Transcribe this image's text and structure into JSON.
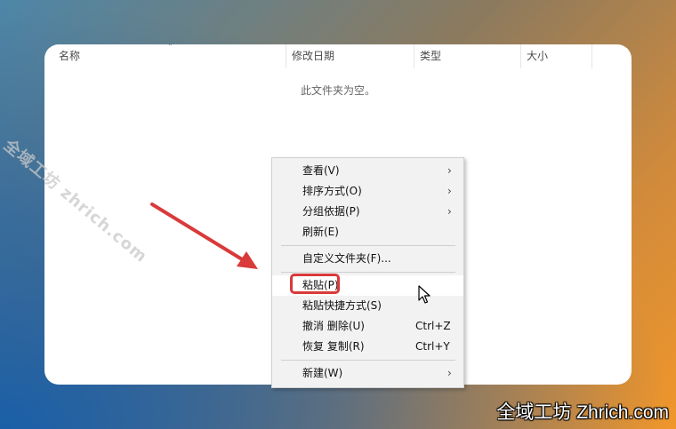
{
  "explorer": {
    "columns": [
      "名称",
      "修改日期",
      "类型",
      "大小"
    ],
    "empty_message": "此文件夹为空。"
  },
  "context_menu": {
    "items": [
      {
        "label": "查看(V)",
        "shortcut": "",
        "submenu": true
      },
      {
        "label": "排序方式(O)",
        "shortcut": "",
        "submenu": true
      },
      {
        "label": "分组依据(P)",
        "shortcut": "",
        "submenu": true
      },
      {
        "label": "刷新(E)",
        "shortcut": "",
        "submenu": false
      },
      {
        "label": "自定义文件夹(F)...",
        "shortcut": "",
        "submenu": false
      },
      {
        "label": "粘贴(P)",
        "shortcut": "",
        "submenu": false,
        "highlighted": true
      },
      {
        "label": "粘贴快捷方式(S)",
        "shortcut": "",
        "submenu": false
      },
      {
        "label": "撤消 删除(U)",
        "shortcut": "Ctrl+Z",
        "submenu": false
      },
      {
        "label": "恢复 复制(R)",
        "shortcut": "Ctrl+Y",
        "submenu": false
      },
      {
        "label": "新建(W)",
        "shortcut": "",
        "submenu": true
      }
    ]
  },
  "annotations": {
    "highlight_color": "#d93a3a",
    "icons": [
      "sort-up-icon",
      "chevron-right-icon",
      "mouse-cursor-icon",
      "red-arrow-icon"
    ]
  },
  "watermark": {
    "diagonal": "全域工坊 zhrich.com",
    "bottom": "全域工坊 Zhrich.com"
  }
}
